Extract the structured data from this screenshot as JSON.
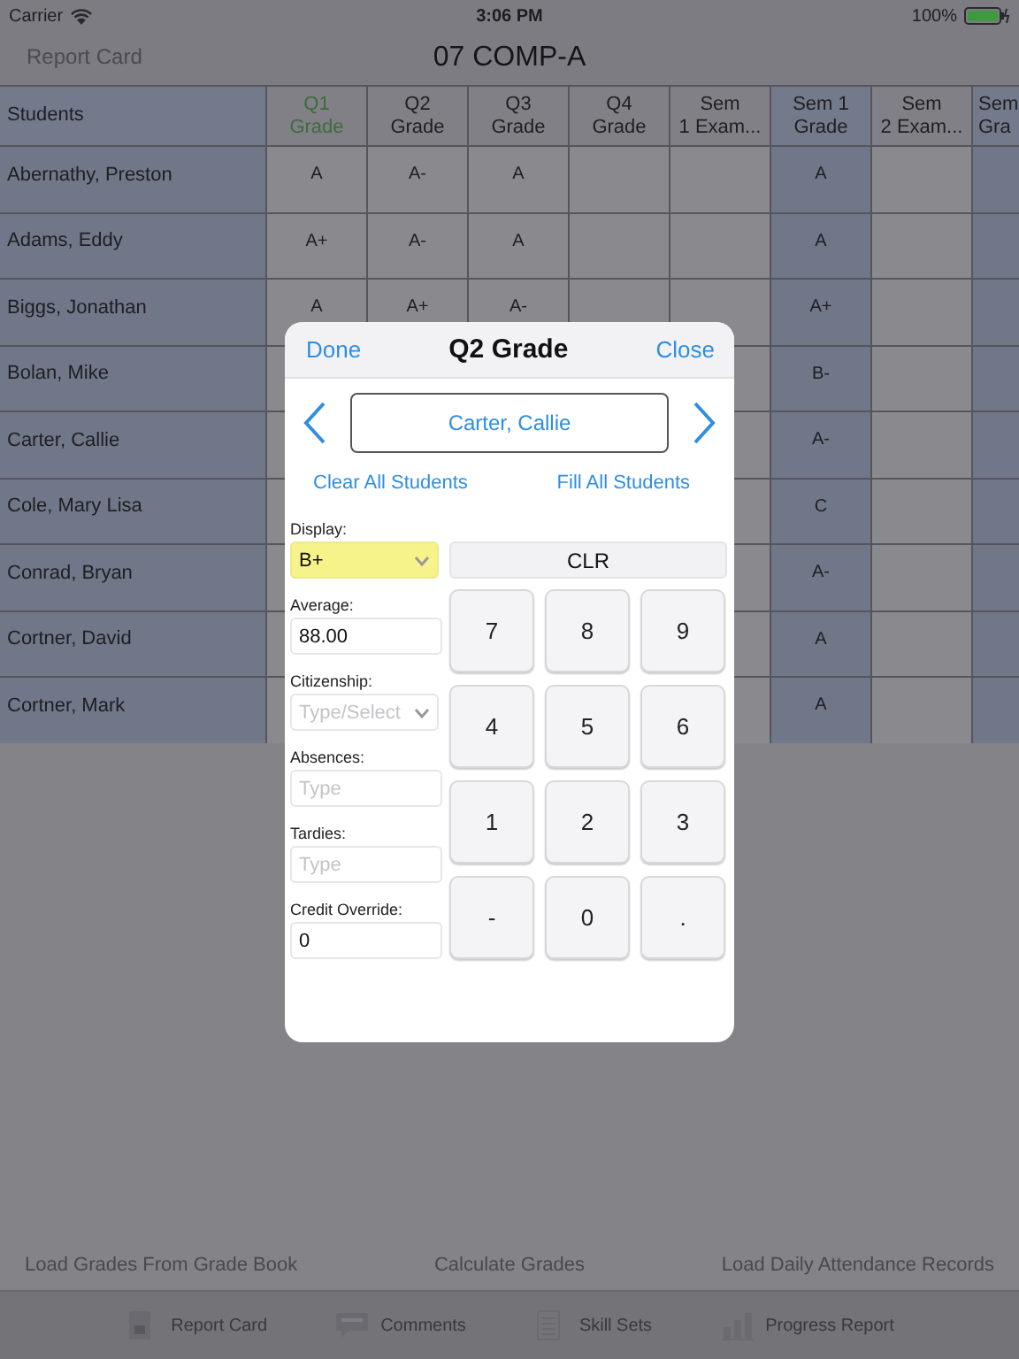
{
  "status_bar": {
    "carrier": "Carrier",
    "time": "3:06 PM",
    "battery": "100%"
  },
  "nav_bar": {
    "back": "Report Card",
    "back_disabled": true,
    "title": "07 COMP-A"
  },
  "table": {
    "columns": [
      {
        "label": "Students",
        "selected": false,
        "shaded": true
      },
      {
        "label": "Q1\nGrade",
        "selected": true,
        "shaded": false
      },
      {
        "label": "Q2\nGrade",
        "selected": false,
        "shaded": false
      },
      {
        "label": "Q3\nGrade",
        "selected": false,
        "shaded": false
      },
      {
        "label": "Q4\nGrade",
        "selected": false,
        "shaded": false
      },
      {
        "label": "Sem\n1 Exam...",
        "selected": false,
        "shaded": false
      },
      {
        "label": "Sem 1\nGrade",
        "selected": false,
        "shaded": true
      },
      {
        "label": "Sem\n2 Exam...",
        "selected": false,
        "shaded": false
      },
      {
        "label": "Sem\nGra",
        "selected": false,
        "shaded": true
      }
    ],
    "rows": [
      {
        "cells": [
          "Abernathy, Preston",
          "A",
          "A-",
          "A",
          null,
          null,
          "A",
          null,
          null
        ]
      },
      {
        "cells": [
          "Adams, Eddy",
          "A+",
          "A-",
          "A",
          null,
          null,
          "A",
          null,
          null
        ]
      },
      {
        "cells": [
          "Biggs, Jonathan",
          "A",
          "A+",
          "A-",
          null,
          null,
          "A+",
          null,
          null
        ]
      },
      {
        "cells": [
          "Bolan, Mike",
          null,
          null,
          null,
          null,
          null,
          "B-",
          null,
          null
        ]
      },
      {
        "cells": [
          "Carter, Callie",
          null,
          null,
          null,
          null,
          null,
          "A-",
          null,
          null
        ]
      },
      {
        "cells": [
          "Cole, Mary Lisa",
          null,
          null,
          null,
          null,
          null,
          "C",
          null,
          null
        ]
      },
      {
        "cells": [
          "Conrad, Bryan",
          null,
          null,
          null,
          null,
          null,
          "A-",
          null,
          null
        ]
      },
      {
        "cells": [
          "Cortner, David",
          null,
          null,
          null,
          null,
          null,
          "A",
          null,
          null
        ]
      },
      {
        "cells": [
          "Cortner, Mark",
          null,
          null,
          null,
          null,
          null,
          "A",
          null,
          null
        ]
      }
    ]
  },
  "actions": [
    "Load Grades From Grade Book",
    "Calculate Grades",
    "Load Daily Attendance Records"
  ],
  "tab_bar": [
    {
      "label": "Report Card",
      "kind": "card"
    },
    {
      "label": "Comments",
      "kind": "chat"
    },
    {
      "label": "Skill Sets",
      "kind": "list"
    },
    {
      "label": "Progress Report",
      "kind": "chart"
    }
  ],
  "modal": {
    "left_button": "Done",
    "title": "Q2 Grade",
    "right_button": "Close",
    "student": "Carter, Callie",
    "clear_all": "Clear All Students",
    "fill_all": "Fill All Students",
    "fields": [
      {
        "label": "Display:",
        "kind": "select",
        "value": "B+",
        "highlighted": true
      },
      {
        "label": "Average:",
        "kind": "input",
        "value": "88.00",
        "highlighted": false
      },
      {
        "label": "Citizenship:",
        "kind": "select",
        "placeholder": "Type/Select",
        "highlighted": false
      },
      {
        "label": "Absences:",
        "kind": "input",
        "placeholder": "Type",
        "highlighted": false
      },
      {
        "label": "Tardies:",
        "kind": "input",
        "placeholder": "Type",
        "highlighted": false
      },
      {
        "label": "Credit Override:",
        "kind": "input",
        "value": "0",
        "highlighted": false
      }
    ],
    "clear_key": "CLR",
    "keys": [
      "7",
      "8",
      "9",
      "4",
      "5",
      "6",
      "1",
      "2",
      "3",
      "-",
      "0",
      "."
    ]
  }
}
